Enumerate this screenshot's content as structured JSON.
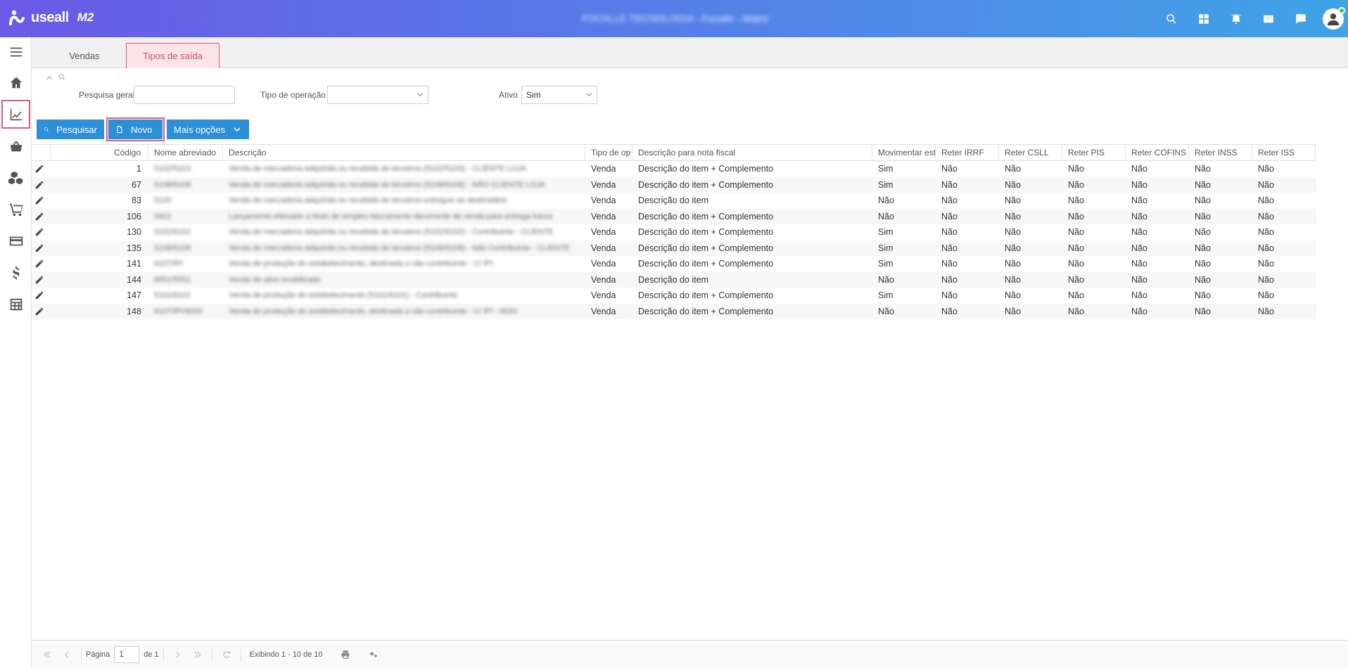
{
  "header": {
    "brand": "useall",
    "brand_sub": "M2",
    "company": "FOCALLE TECNOLOGIA - Focalle - Matriz"
  },
  "tabs": [
    {
      "label": "Vendas"
    },
    {
      "label": "Tipos de saída"
    }
  ],
  "filters": {
    "general_label": "Pesquisa geral",
    "general_value": "",
    "optype_label": "Tipo de operação",
    "optype_value": "",
    "active_label": "Ativo",
    "active_value": "Sim"
  },
  "buttons": {
    "search": "Pesquisar",
    "new": "Novo",
    "more": "Mais opções"
  },
  "columns": [
    "Código",
    "Nome abreviado",
    "Descrição",
    "Tipo de op",
    "Descrição para nota fiscal",
    "Movimentar est",
    "Reter IRRF",
    "Reter CSLL",
    "Reter PIS",
    "Reter COFINS",
    "Reter INSS",
    "Reter ISS"
  ],
  "rows": [
    {
      "code": "1",
      "short": "5102/5103",
      "desc": "Venda de mercadoria adquirida ou recebida de terceiros (5102/5103) - CLIENTE LOJA",
      "type": "Venda",
      "nf": "Descrição do item + Complemento",
      "stock": "Sim",
      "irrf": "Não",
      "csll": "Não",
      "pis": "Não",
      "cofins": "Não",
      "inss": "Não",
      "iss": "Não"
    },
    {
      "code": "67",
      "short": "5108/6108",
      "desc": "Venda de mercadoria adquirida ou recebida de terceiros (5108/6108) - NÃO CLIENTE LOJA",
      "type": "Venda",
      "nf": "Descrição do item + Complemento",
      "stock": "Sim",
      "irrf": "Não",
      "csll": "Não",
      "pis": "Não",
      "cofins": "Não",
      "inss": "Não",
      "iss": "Não"
    },
    {
      "code": "83",
      "short": "5120",
      "desc": "Venda de mercadoria adquirida ou recebida de terceiros entregue ao destinatário",
      "type": "Venda",
      "nf": "Descrição do item",
      "stock": "Não",
      "irrf": "Não",
      "csll": "Não",
      "pis": "Não",
      "cofins": "Não",
      "inss": "Não",
      "iss": "Não"
    },
    {
      "code": "106",
      "short": "5922",
      "desc": "Lançamento efetuado a título de simples faturamento decorrente de venda para entrega futura",
      "type": "Venda",
      "nf": "Descrição do item + Complemento",
      "stock": "Não",
      "irrf": "Não",
      "csll": "Não",
      "pis": "Não",
      "cofins": "Não",
      "inss": "Não",
      "iss": "Não"
    },
    {
      "code": "130",
      "short": "5102/6102",
      "desc": "Venda de mercadoria adquirida ou recebida de terceiros (5102/6102) - Contribuinte - CLIENTE",
      "type": "Venda",
      "nf": "Descrição do item + Complemento",
      "stock": "Sim",
      "irrf": "Não",
      "csll": "Não",
      "pis": "Não",
      "cofins": "Não",
      "inss": "Não",
      "iss": "Não"
    },
    {
      "code": "135",
      "short": "5108/6108",
      "desc": "Venda de mercadoria adquirida ou recebida de terceiros (5108/6108) - Não Contribuinte - CLIENTE",
      "type": "Venda",
      "nf": "Descrição do item + Complemento",
      "stock": "Sim",
      "irrf": "Não",
      "csll": "Não",
      "pis": "Não",
      "cofins": "Não",
      "inss": "Não",
      "iss": "Não"
    },
    {
      "code": "141",
      "short": "6107/IPI",
      "desc": "Venda de produção do estabelecimento, destinada a não contribuinte - C/ IPI",
      "type": "Venda",
      "nf": "Descrição do item + Complemento",
      "stock": "Sim",
      "irrf": "Não",
      "csll": "Não",
      "pis": "Não",
      "cofins": "Não",
      "inss": "Não",
      "iss": "Não"
    },
    {
      "code": "144",
      "short": "6551/5551",
      "desc": "Venda de ativo imobilizado",
      "type": "Venda",
      "nf": "Descrição do item",
      "stock": "Não",
      "irrf": "Não",
      "csll": "Não",
      "pis": "Não",
      "cofins": "Não",
      "inss": "Não",
      "iss": "Não"
    },
    {
      "code": "147",
      "short": "5101/6101",
      "desc": "Venda de produção do estabelecimento (5101/6101) - Contribuinte",
      "type": "Venda",
      "nf": "Descrição do item + Complemento",
      "stock": "Sim",
      "irrf": "Não",
      "csll": "Não",
      "pis": "Não",
      "cofins": "Não",
      "inss": "Não",
      "iss": "Não"
    },
    {
      "code": "148",
      "short": "6107/IPI/9020",
      "desc": "Venda de produção do estabelecimento, destinada a não contribuinte - C/ IPI - 9020",
      "type": "Venda",
      "nf": "Descrição do item + Complemento",
      "stock": "Não",
      "irrf": "Não",
      "csll": "Não",
      "pis": "Não",
      "cofins": "Não",
      "inss": "Não",
      "iss": "Não"
    }
  ],
  "pager": {
    "page_label": "Página",
    "page_value": "1",
    "of_label": "de 1",
    "showing": "Exibindo 1 - 10 de 10"
  }
}
